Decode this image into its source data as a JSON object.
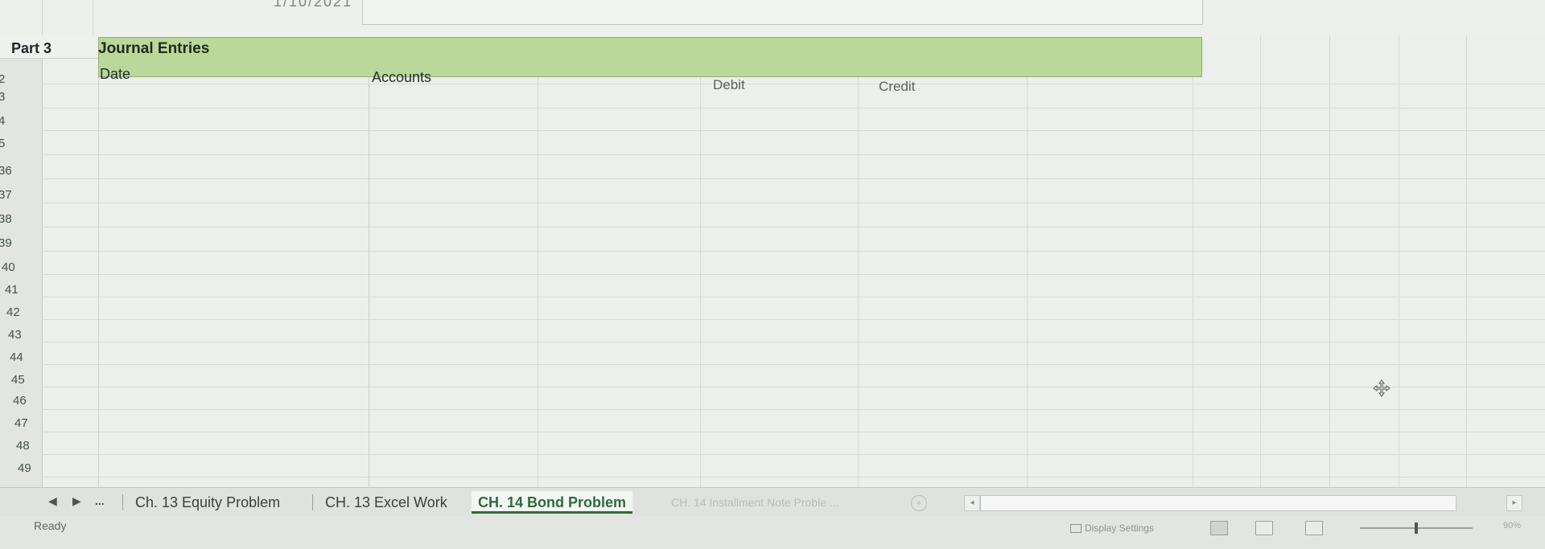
{
  "top": {
    "faded_date": "1/10/2021"
  },
  "part": {
    "label": "Part 3",
    "title": "Journal Entries"
  },
  "columns": {
    "date": "Date",
    "accounts": "Accounts",
    "debit": "Debit",
    "credit": "Credit"
  },
  "row_numbers": [
    "2",
    "3",
    "4",
    "5",
    "36",
    "37",
    "38",
    "39",
    "40",
    "41",
    "42",
    "43",
    "44",
    "45",
    "46",
    "47",
    "48",
    "49"
  ],
  "tabs": {
    "nav_prev": "◀",
    "nav_next": "▶",
    "more": "...",
    "items": [
      "Ch. 13 Equity Problem",
      "CH. 13 Excel Work",
      "CH. 14 Bond Problem",
      "CH. 14 Installment Note Proble ..."
    ],
    "add": "+"
  },
  "status": {
    "ready": "Ready",
    "display_settings": "Display Settings",
    "zoom": "90%"
  },
  "icons": {
    "cursor": "cursor-move-icon",
    "display": "display-settings-icon"
  },
  "colors": {
    "banner": "#b9d89a",
    "active_tab": "#2d6a3c"
  }
}
